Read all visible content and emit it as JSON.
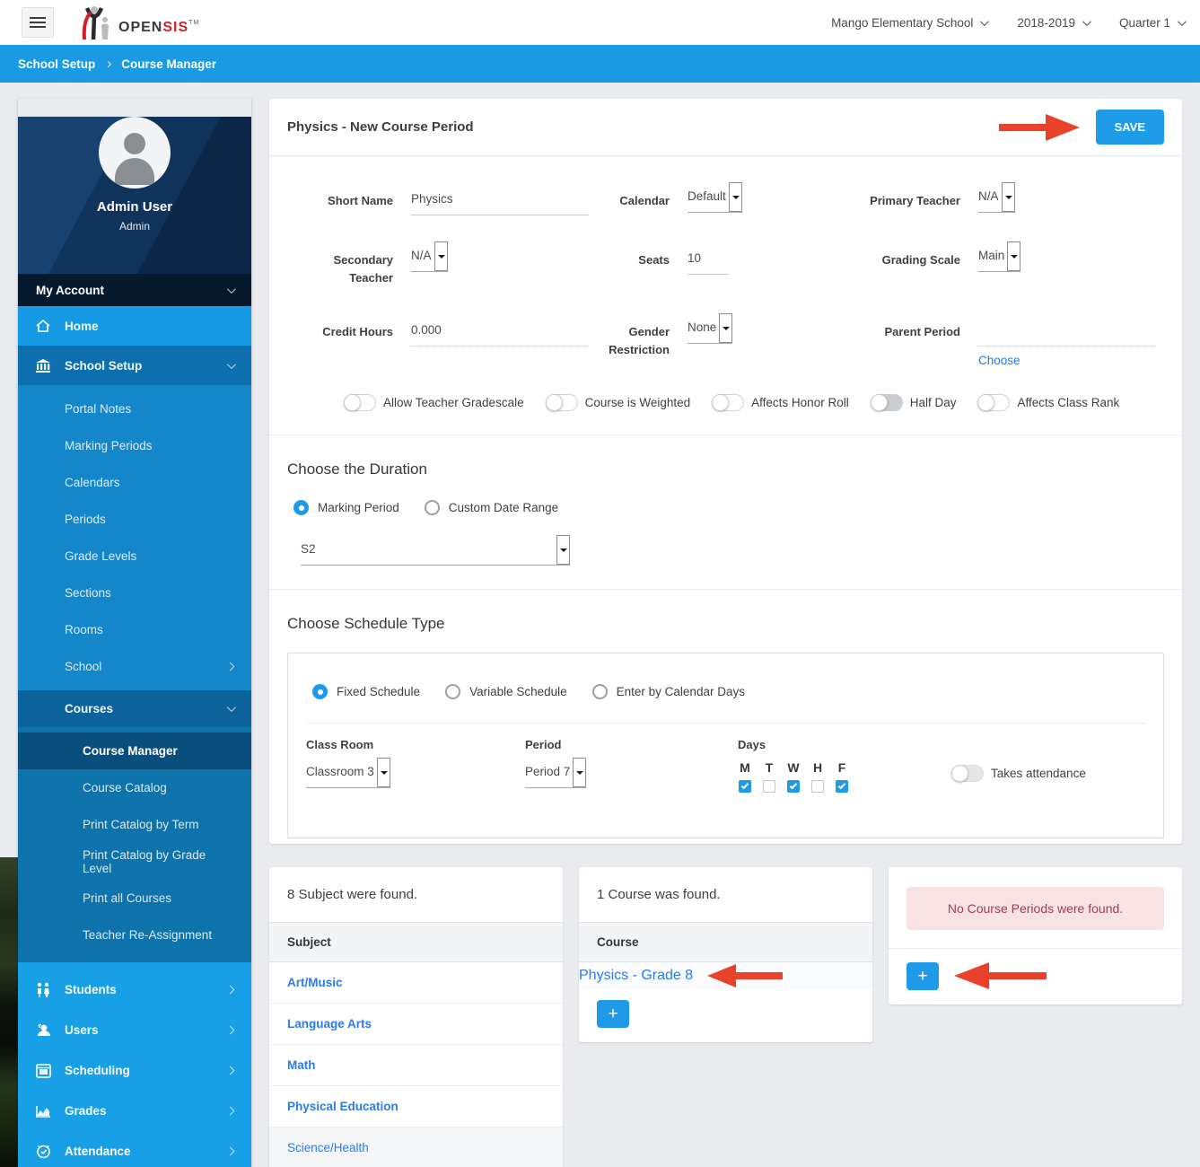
{
  "header": {
    "logo_open": "OPEN",
    "logo_sis": "SIS",
    "logo_tm": "TM",
    "school_selector": "Mango Elementary School",
    "year_selector": "2018-2019",
    "quarter_selector": "Quarter 1"
  },
  "breadcrumb": {
    "parent": "School Setup",
    "current": "Course Manager"
  },
  "sidebar": {
    "profile": {
      "name": "Admin User",
      "role": "Admin"
    },
    "my_account_label": "My Account",
    "home_label": "Home",
    "school_setup_label": "School Setup",
    "school_setup_items": [
      "Portal Notes",
      "Marking Periods",
      "Calendars",
      "Periods",
      "Grade Levels",
      "Sections",
      "Rooms",
      "School"
    ],
    "courses_label": "Courses",
    "courses_items": [
      "Course Manager",
      "Course Catalog",
      "Print Catalog by Term",
      "Print Catalog by Grade Level",
      "Print all Courses",
      "Teacher Re-Assignment"
    ],
    "active_item": "Course Manager",
    "bottom_items": [
      "Students",
      "Users",
      "Scheduling",
      "Grades",
      "Attendance"
    ]
  },
  "course_period_form": {
    "title": "Physics - New Course Period",
    "save_label": "SAVE",
    "short_name_label": "Short Name",
    "short_name_value": "Physics",
    "calendar_label": "Calendar",
    "calendar_value": "Default",
    "primary_teacher_label": "Primary Teacher",
    "primary_teacher_value": "N/A",
    "secondary_teacher_label": "Secondary Teacher",
    "secondary_teacher_value": "N/A",
    "seats_label": "Seats",
    "seats_value": "10",
    "grading_scale_label": "Grading Scale",
    "grading_scale_value": "Main",
    "credit_hours_label": "Credit Hours",
    "credit_hours_value": "0.000",
    "gender_restriction_label": "Gender Restriction",
    "gender_restriction_value": "None",
    "parent_period_label": "Parent Period",
    "parent_period_choose": "Choose",
    "toggles": [
      "Allow Teacher Gradescale",
      "Course is Weighted",
      "Affects Honor Roll",
      "Half Day",
      "Affects Class Rank"
    ]
  },
  "duration_section": {
    "title": "Choose the Duration",
    "radio_marking_period": "Marking Period",
    "radio_custom_range": "Custom Date Range",
    "selected": "Marking Period",
    "marking_period_value": "S2"
  },
  "schedule_section": {
    "title": "Choose Schedule Type",
    "radio_fixed": "Fixed Schedule",
    "radio_variable": "Variable Schedule",
    "radio_calendar_days": "Enter by Calendar Days",
    "selected": "Fixed Schedule",
    "class_room_label": "Class Room",
    "class_room_value": "Classroom 3",
    "period_label": "Period",
    "period_value": "Period 7",
    "days_label": "Days",
    "days": [
      {
        "letter": "M",
        "checked": true
      },
      {
        "letter": "T",
        "checked": false
      },
      {
        "letter": "W",
        "checked": true
      },
      {
        "letter": "H",
        "checked": false
      },
      {
        "letter": "F",
        "checked": true
      }
    ],
    "takes_attendance_label": "Takes attendance"
  },
  "subjects_panel": {
    "found_text": "8 Subject were found.",
    "column_header": "Subject",
    "items": [
      "Art/Music",
      "Language Arts",
      "Math",
      "Physical Education",
      "Science/Health"
    ]
  },
  "courses_panel": {
    "found_text": "1 Course was found.",
    "column_header": "Course",
    "course_link": "Physics - Grade 8",
    "add_label": "+"
  },
  "periods_panel": {
    "alert_text": "No Course Periods were found.",
    "add_label": "+"
  },
  "colors": {
    "accent_blue": "#1f9ce8",
    "sidebar_blue": "#1487cb",
    "arrow_red": "#e8432a",
    "link_blue": "#2a7af0",
    "alert_bg": "#f7e3e3",
    "alert_text": "#a03e4d"
  }
}
